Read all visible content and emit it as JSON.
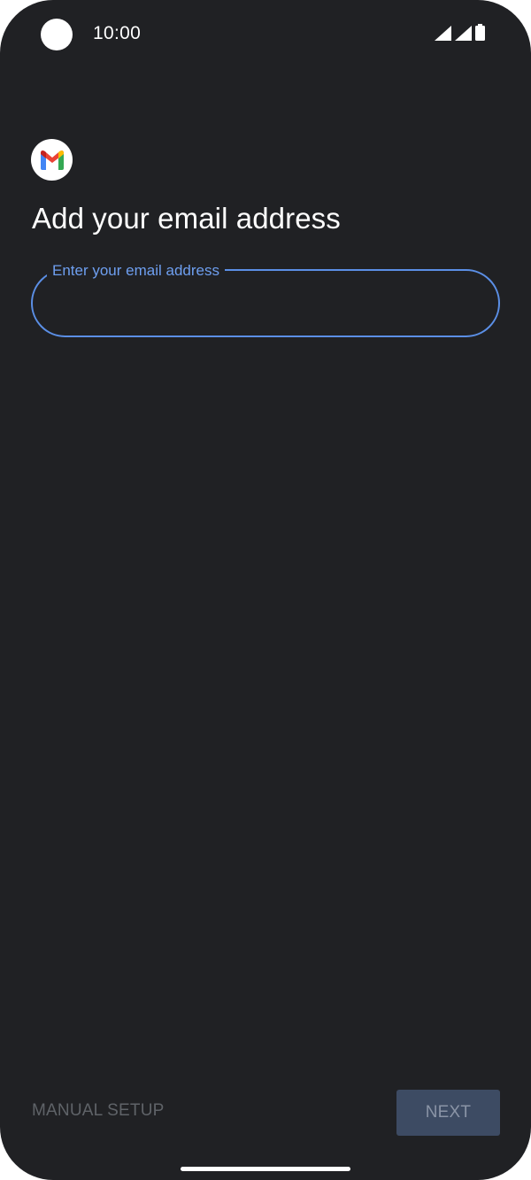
{
  "status_bar": {
    "time": "10:00",
    "icons": [
      "signal-icon",
      "signal-icon",
      "battery-icon"
    ]
  },
  "app": {
    "logo_icon": "gmail-logo-icon"
  },
  "page": {
    "title": "Add your email address"
  },
  "email_field": {
    "label": "Enter your email address",
    "value": ""
  },
  "actions": {
    "manual_setup_label": "MANUAL SETUP",
    "next_label": "NEXT"
  },
  "colors": {
    "background": "#202124",
    "accent": "#5b8fe6",
    "next_button_bg": "#3d4b63",
    "disabled_text": "#5f6368"
  }
}
